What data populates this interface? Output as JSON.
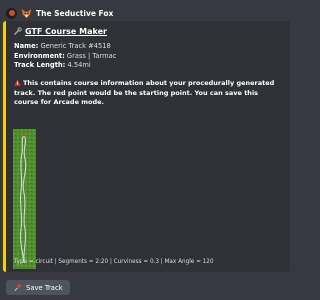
{
  "message": {
    "username": "The Seductive Fox",
    "avatar_icon": "avatar-icon",
    "name_icon": "fox-icon"
  },
  "embed": {
    "accent_color": "#f5d00f",
    "title_icon": "wrench-icon",
    "title": "GTF Course Maker",
    "fields": [
      {
        "label": "Name:",
        "value": "Generic Track #4518"
      },
      {
        "label": "Environment:",
        "value": "Grass | Tarmac"
      },
      {
        "label": "Track Length:",
        "value": "4.54mi"
      }
    ],
    "description_icon": "info-icon",
    "description": "This contains course information about your procedurally generated track. The red point would be the starting point. You can save this course for Arcade mode.",
    "params": "Type = circuit | Segments = 2:20 | Curviness = 0.3 | Max Angle = 120"
  },
  "actions": {
    "save_icon": "pushpin-icon",
    "save_label": "Save Track"
  }
}
